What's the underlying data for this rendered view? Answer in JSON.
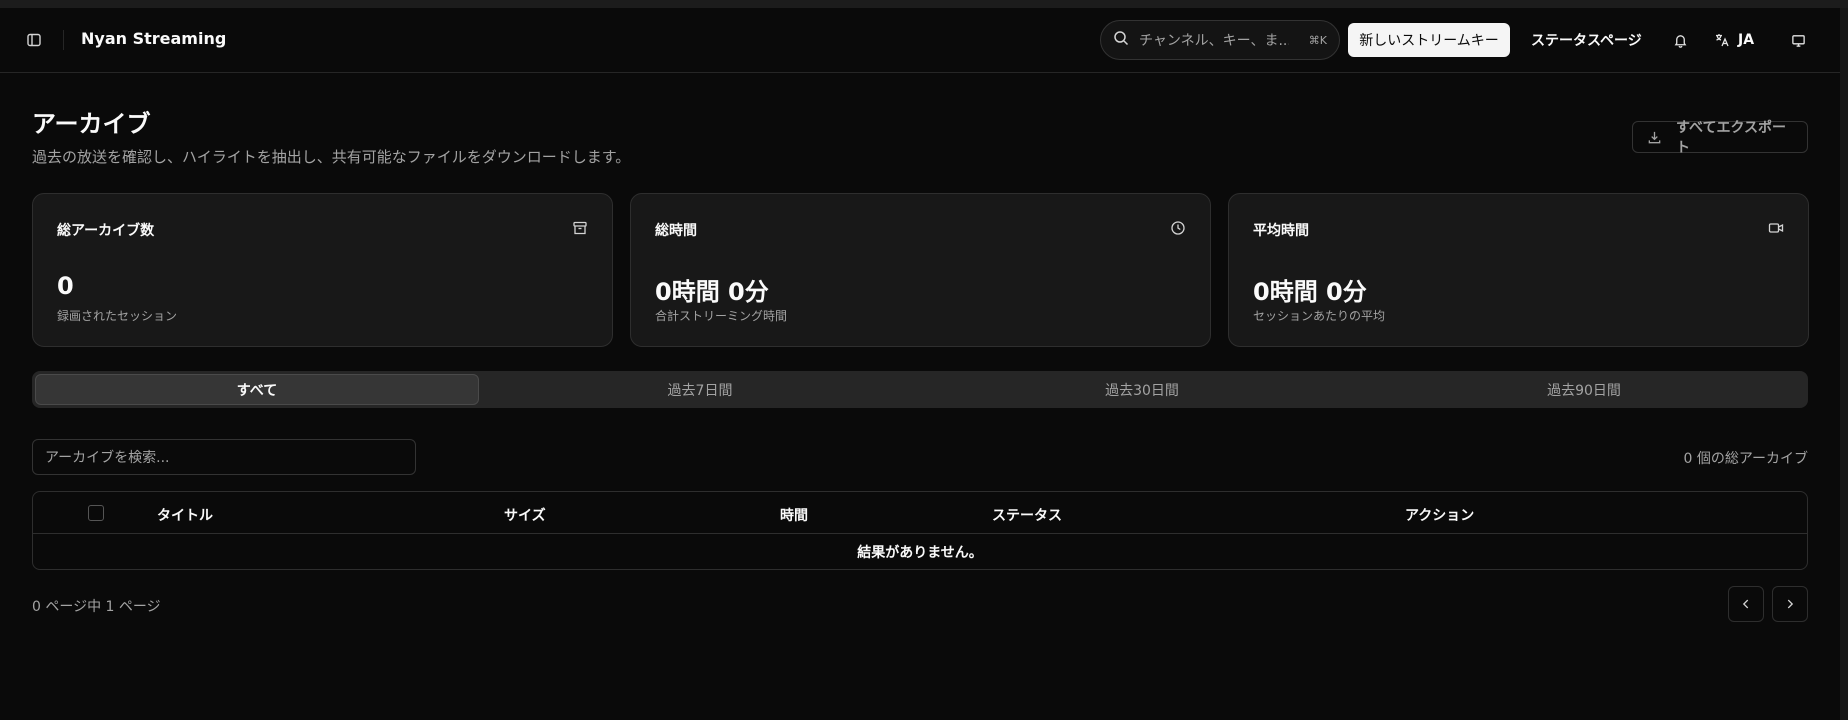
{
  "header": {
    "app_title": "Nyan Streaming",
    "search_placeholder": "チャンネル、キー、ま...",
    "search_shortcut": "⌘K",
    "new_stream_key_label": "新しいストリームキー",
    "status_page_label": "ステータスページ",
    "language_label": "JA"
  },
  "page": {
    "title": "アーカイブ",
    "subtitle": "過去の放送を確認し、ハイライトを抽出し、共有可能なファイルをダウンロードします。",
    "export_label": "すべてエクスポート"
  },
  "stats": [
    {
      "title": "総アーカイブ数",
      "value": "0",
      "caption": "録画されたセッション",
      "icon": "archive-icon"
    },
    {
      "title": "総時間",
      "value": "0時間 0分",
      "caption": "合計ストリーミング時間",
      "icon": "clock-icon"
    },
    {
      "title": "平均時間",
      "value": "0時間 0分",
      "caption": "セッションあたりの平均",
      "icon": "video-icon"
    }
  ],
  "tabs": [
    {
      "label": "すべて",
      "active": true
    },
    {
      "label": "過去7日間",
      "active": false
    },
    {
      "label": "過去30日間",
      "active": false
    },
    {
      "label": "過去90日間",
      "active": false
    }
  ],
  "archive_search": {
    "placeholder": "アーカイブを検索..."
  },
  "total_count": "0 個の総アーカイブ",
  "table": {
    "columns": [
      "タイトル",
      "サイズ",
      "時間",
      "ステータス",
      "アクション"
    ],
    "empty_text": "結果がありません。"
  },
  "pagination": {
    "info": "0 ページ中 1 ページ"
  }
}
